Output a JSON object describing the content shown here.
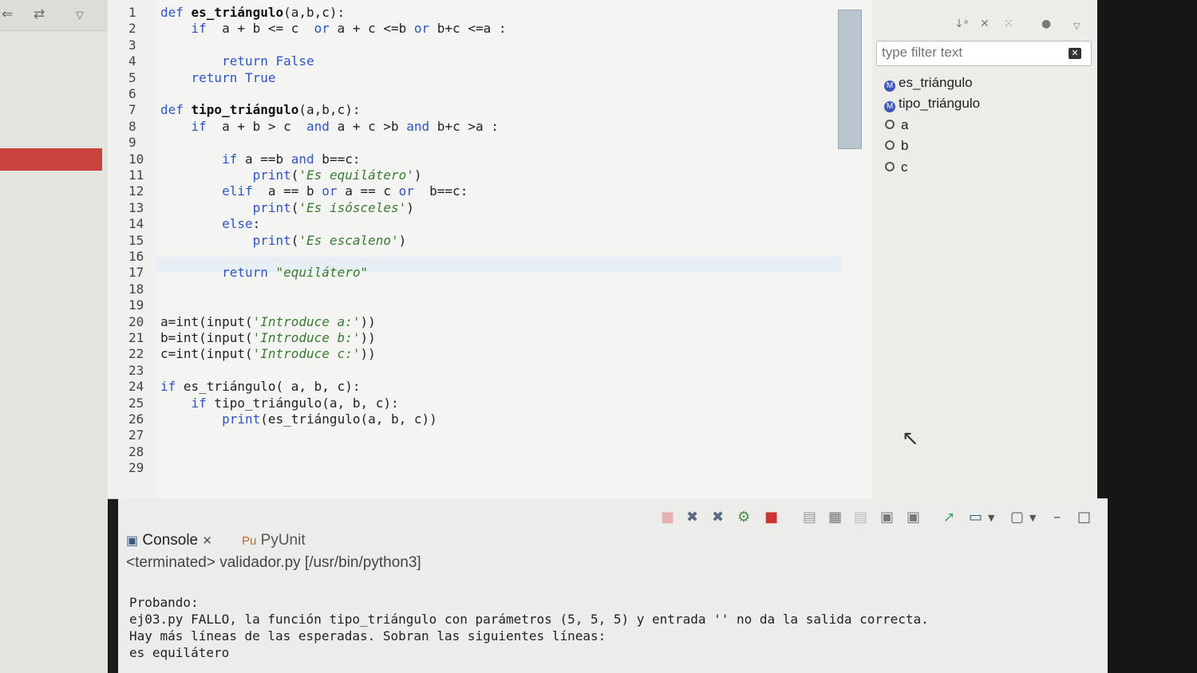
{
  "left_panel": {
    "toolbar_icons": [
      "collapse-icon",
      "link-icon",
      "menu-chevron-icon"
    ]
  },
  "editor": {
    "lines": [
      {
        "n": "1",
        "tokens": [
          [
            "kw",
            "def "
          ],
          [
            "fn",
            "es_triángulo"
          ],
          [
            "",
            "(a,b,c):"
          ]
        ]
      },
      {
        "n": "2",
        "tokens": [
          [
            "",
            "    "
          ],
          [
            "kw",
            "if"
          ],
          [
            "",
            "  a + b <= c  "
          ],
          [
            "kw",
            "or"
          ],
          [
            "",
            " a + c <=b "
          ],
          [
            "kw",
            "or"
          ],
          [
            "",
            " b+c <=a :"
          ]
        ]
      },
      {
        "n": "3",
        "tokens": []
      },
      {
        "n": "4",
        "tokens": [
          [
            "",
            "        "
          ],
          [
            "kw",
            "return False"
          ]
        ]
      },
      {
        "n": "5",
        "tokens": [
          [
            "",
            "    "
          ],
          [
            "kw",
            "return True"
          ]
        ]
      },
      {
        "n": "6",
        "tokens": []
      },
      {
        "n": "7",
        "tokens": [
          [
            "kw",
            "def "
          ],
          [
            "fn",
            "tipo_triángulo"
          ],
          [
            "",
            "(a,b,c):"
          ]
        ]
      },
      {
        "n": "8",
        "tokens": [
          [
            "",
            "    "
          ],
          [
            "kw",
            "if"
          ],
          [
            "",
            "  a + b > c  "
          ],
          [
            "kw",
            "and"
          ],
          [
            "",
            " a + c >b "
          ],
          [
            "kw",
            "and"
          ],
          [
            "",
            " b+c >a :"
          ]
        ]
      },
      {
        "n": "9",
        "tokens": []
      },
      {
        "n": "10",
        "tokens": [
          [
            "",
            "        "
          ],
          [
            "kw",
            "if"
          ],
          [
            "",
            " a ==b "
          ],
          [
            "kw",
            "and"
          ],
          [
            "",
            " b==c:"
          ]
        ]
      },
      {
        "n": "11",
        "tokens": [
          [
            "",
            "            "
          ],
          [
            "builtin",
            "print"
          ],
          [
            "",
            "("
          ],
          [
            "str",
            "'Es equilátero'"
          ],
          [
            "",
            ")"
          ]
        ]
      },
      {
        "n": "12",
        "tokens": [
          [
            "",
            "        "
          ],
          [
            "kw",
            "elif"
          ],
          [
            "",
            "  a == b "
          ],
          [
            "kw",
            "or"
          ],
          [
            "",
            " a == c "
          ],
          [
            "kw",
            "or"
          ],
          [
            "",
            "  b==c:"
          ]
        ]
      },
      {
        "n": "13",
        "tokens": [
          [
            "",
            "            "
          ],
          [
            "builtin",
            "print"
          ],
          [
            "",
            "("
          ],
          [
            "str",
            "'Es isósceles'"
          ],
          [
            "",
            ")"
          ]
        ]
      },
      {
        "n": "14",
        "tokens": [
          [
            "",
            "        "
          ],
          [
            "kw",
            "else"
          ],
          [
            "",
            ":"
          ]
        ]
      },
      {
        "n": "15",
        "tokens": [
          [
            "",
            "            "
          ],
          [
            "builtin",
            "print"
          ],
          [
            "",
            "("
          ],
          [
            "str",
            "'Es escaleno'"
          ],
          [
            "",
            ")"
          ]
        ]
      },
      {
        "n": "16",
        "tokens": []
      },
      {
        "n": "17",
        "tokens": [
          [
            "",
            "        "
          ],
          [
            "kw",
            "return "
          ],
          [
            "str",
            "\"equilátero\""
          ]
        ]
      },
      {
        "n": "18",
        "tokens": []
      },
      {
        "n": "19",
        "tokens": []
      },
      {
        "n": "20",
        "tokens": [
          [
            "",
            "a=int(input("
          ],
          [
            "str",
            "'Introduce a:'"
          ],
          [
            "",
            "))"
          ]
        ]
      },
      {
        "n": "21",
        "tokens": [
          [
            "",
            "b=int(input("
          ],
          [
            "str",
            "'Introduce b:'"
          ],
          [
            "",
            "))"
          ]
        ]
      },
      {
        "n": "22",
        "tokens": [
          [
            "",
            "c=int(input("
          ],
          [
            "str",
            "'Introduce c:'"
          ],
          [
            "",
            "))"
          ]
        ]
      },
      {
        "n": "23",
        "tokens": []
      },
      {
        "n": "24",
        "tokens": [
          [
            "kw",
            "if"
          ],
          [
            "",
            " es_triángulo( a, b, c):"
          ]
        ]
      },
      {
        "n": "25",
        "tokens": [
          [
            "",
            "    "
          ],
          [
            "kw",
            "if"
          ],
          [
            "",
            " tipo_triángulo(a, b, c):"
          ]
        ]
      },
      {
        "n": "26",
        "tokens": [
          [
            "",
            "        "
          ],
          [
            "builtin",
            "print"
          ],
          [
            "",
            "(es_triángulo(a, b, c))"
          ]
        ]
      },
      {
        "n": "27",
        "tokens": []
      },
      {
        "n": "28",
        "tokens": []
      },
      {
        "n": "29",
        "tokens": []
      }
    ]
  },
  "outline": {
    "filter_placeholder": "type filter text",
    "items": [
      {
        "label": "es_triángulo",
        "kind": "function"
      },
      {
        "label": "tipo_triángulo",
        "kind": "function"
      },
      {
        "label": "a",
        "kind": "variable"
      },
      {
        "label": "b",
        "kind": "variable"
      },
      {
        "label": "c",
        "kind": "variable"
      }
    ]
  },
  "console": {
    "tab_console": "Console",
    "tab_pyunit": "PyUnit",
    "terminated": "<terminated> validador.py [/usr/bin/python3]",
    "output": [
      "Probando:",
      "ej03.py FALLO, la función tipo_triángulo con parámetros (5, 5, 5) y entrada '' no da la salida correcta.",
      "Hay más líneas de las esperadas. Sobran las siguientes líneas:",
      "es equilátero"
    ]
  }
}
